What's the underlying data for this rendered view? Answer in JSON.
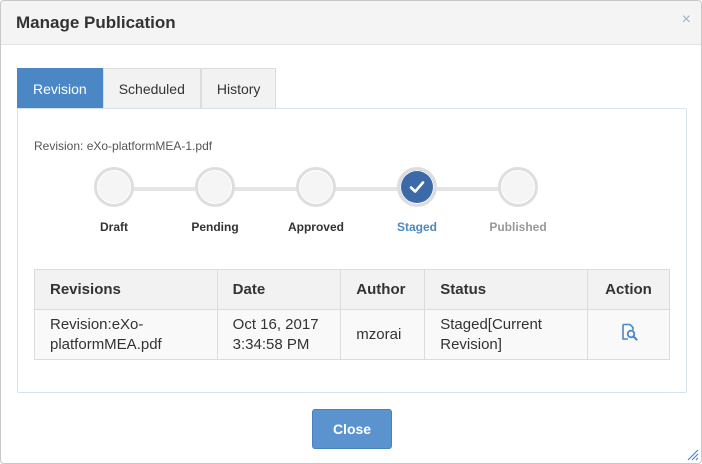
{
  "dialog": {
    "title": "Manage Publication",
    "close_glyph": "×"
  },
  "tabs": [
    {
      "label": "Revision",
      "active": true
    },
    {
      "label": "Scheduled",
      "active": false
    },
    {
      "label": "History",
      "active": false
    }
  ],
  "revision_label": "Revision: eXo-platformMEA-1.pdf",
  "steps": [
    {
      "label": "Draft",
      "state": "pending"
    },
    {
      "label": "Pending",
      "state": "pending"
    },
    {
      "label": "Approved",
      "state": "pending"
    },
    {
      "label": "Staged",
      "state": "current"
    },
    {
      "label": "Published",
      "state": "future"
    }
  ],
  "table": {
    "headers": [
      "Revisions",
      "Date",
      "Author",
      "Status",
      "Action"
    ],
    "rows": [
      {
        "revision": "Revision:eXo-platformMEA.pdf",
        "date": "Oct 16, 2017 3:34:58 PM",
        "author": "mzorai",
        "status": "Staged[Current Revision]",
        "action_icon": "view-document-icon"
      }
    ]
  },
  "footer": {
    "close_label": "Close"
  },
  "colors": {
    "accent": "#4b87c5",
    "step_done": "#3c6aa8",
    "button": "#5b93cf"
  }
}
